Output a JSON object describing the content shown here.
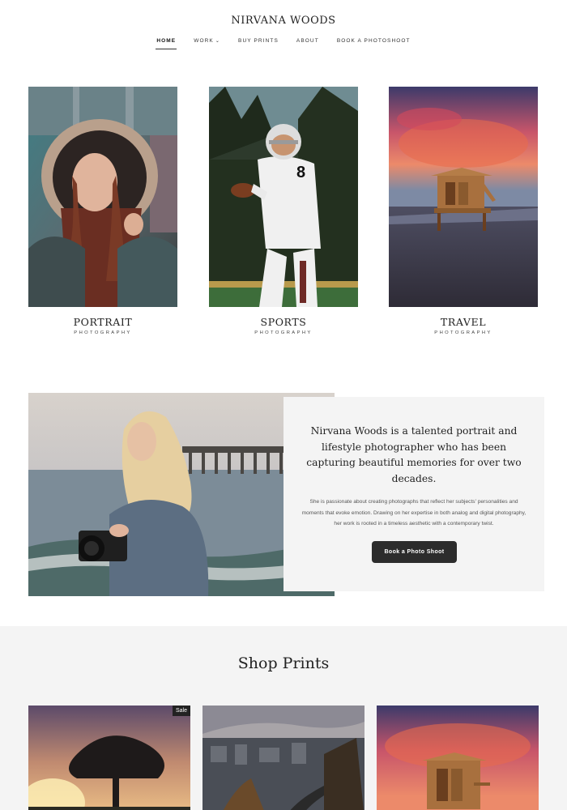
{
  "site": {
    "title": "NIRVANA WOODS"
  },
  "nav": {
    "items": [
      {
        "label": "HOME",
        "active": true
      },
      {
        "label": "WORK",
        "has_dropdown": true
      },
      {
        "label": "BUY PRINTS"
      },
      {
        "label": "ABOUT"
      },
      {
        "label": "BOOK A PHOTOSHOOT"
      }
    ],
    "dropdown_icon": "chevron-down-icon"
  },
  "categories": [
    {
      "title": "PORTRAIT",
      "subtitle": "PHOTOGRAPHY"
    },
    {
      "title": "SPORTS",
      "subtitle": "PHOTOGRAPHY"
    },
    {
      "title": "TRAVEL",
      "subtitle": "PHOTOGRAPHY"
    }
  ],
  "about": {
    "headline": "Nirvana Woods is a talented portrait and lifestyle photographer who has been capturing beautiful memories for over two decades.",
    "body": "She is passionate about creating photographs that reflect her subjects' personalities and moments that evoke emotion. Drawing on her expertise in both analog and digital photography, her work is rooted in a timeless aesthetic with a contemporary twist.",
    "button_label": "Book a Photo Shoot"
  },
  "shop": {
    "title": "Shop Prints",
    "sale_badge": "Sale"
  },
  "colors": {
    "button_bg": "#2c2c2c",
    "card_bg": "#f4f4f4",
    "text": "#222222"
  }
}
